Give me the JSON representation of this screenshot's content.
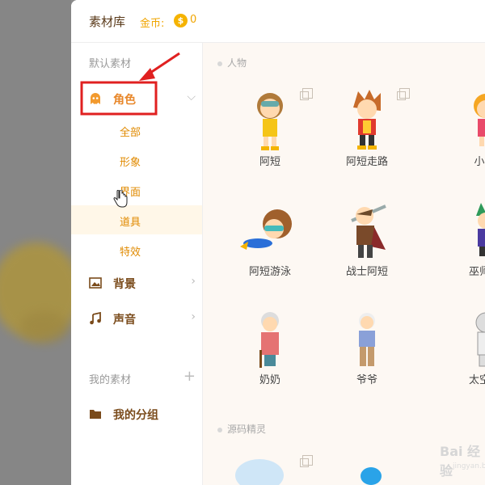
{
  "header": {
    "title": "素材库",
    "coins_label": "金币:",
    "coins_value": "0",
    "coin_symbol": "$"
  },
  "sidebar": {
    "default_section": "默认素材",
    "items": [
      {
        "label": "角色",
        "icon": "ghost-icon"
      },
      {
        "label": "背景",
        "icon": "image-icon"
      },
      {
        "label": "声音",
        "icon": "music-icon"
      }
    ],
    "sub_items": [
      "全部",
      "形象",
      "界面",
      "道具",
      "特效"
    ],
    "my_section": "我的素材",
    "my_group": "我的分组"
  },
  "main": {
    "categories": [
      "人物",
      "源码精灵"
    ],
    "cards": [
      {
        "name": "阿短"
      },
      {
        "name": "阿短走路"
      },
      {
        "name": "小"
      },
      {
        "name": "阿短游泳"
      },
      {
        "name": "战士阿短"
      },
      {
        "name": "巫师"
      },
      {
        "name": "奶奶"
      },
      {
        "name": "爷爷"
      },
      {
        "name": "太空"
      }
    ]
  },
  "watermark": {
    "text": "Bai 经验",
    "sub": "jingyan.baidu.com"
  },
  "colors": {
    "accent": "#f0a500",
    "highlight_box": "#e02020",
    "brown": "#7a4b1b"
  }
}
